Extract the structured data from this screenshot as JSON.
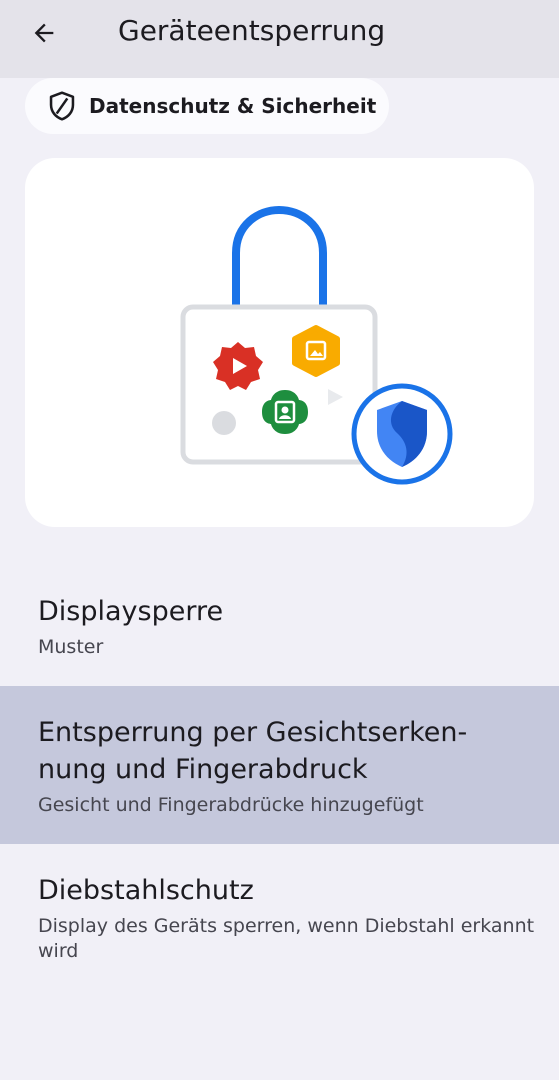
{
  "app_bar": {
    "title": "Geräteentsperrung",
    "back_icon": "arrow-back-icon"
  },
  "breadcrumb": {
    "icon": "shield-outline-icon",
    "label": "Datenschutz & Sicherheit"
  },
  "illustration": {
    "icons": [
      "padlock-icon",
      "youtube-play-icon",
      "gallery-icon",
      "contacts-icon",
      "security-shield-icon"
    ],
    "colors": {
      "lock_shackle": "#1a73e8",
      "red": "#d93025",
      "yellow": "#f9ab00",
      "green": "#1e8e3e",
      "shield_blue": "#4285f4",
      "shield_dark": "#1a56c8"
    }
  },
  "settings": [
    {
      "title": "Displaysperre",
      "summary": "Muster",
      "highlighted": false
    },
    {
      "title_line1": "Entsperrung per Gesichtserken-",
      "title_line2": "nung und Fingerabdruck",
      "summary": "Gesicht und Fingerabdrücke hinzugefügt",
      "highlighted": true
    },
    {
      "title": "Diebstahlschutz",
      "summary_line1": "Display des Geräts sperren, wenn Diebstahl erkannt",
      "summary_line2": "wird",
      "highlighted": false
    }
  ]
}
